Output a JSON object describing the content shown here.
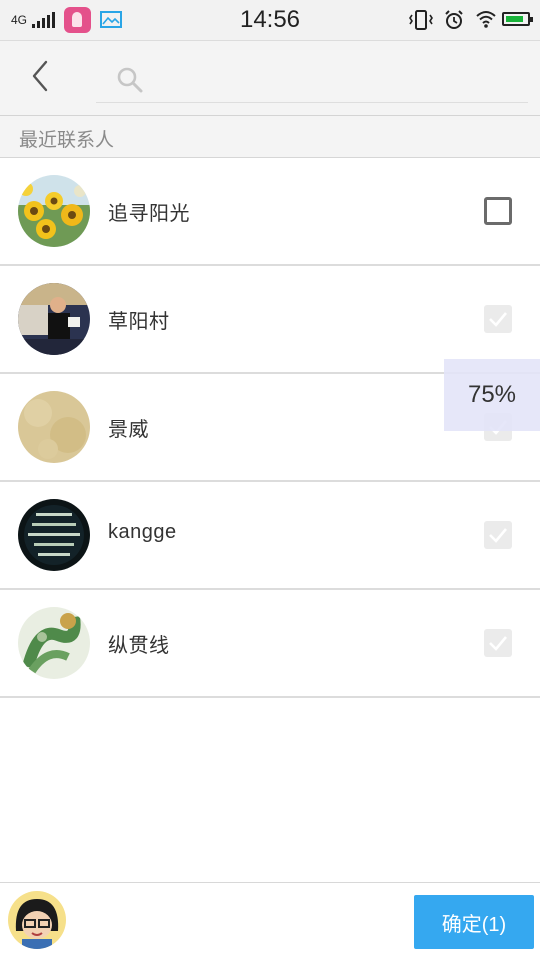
{
  "status_bar": {
    "network": "4G",
    "time": "14:56",
    "battery_level": 0.85,
    "colors": {
      "app_icon": "#e4518b",
      "image_icon": "#2aa5e6",
      "battery": "#19b33a"
    }
  },
  "header": {
    "back_icon": "chevron-left-icon",
    "search_icon": "search-icon",
    "search_placeholder": "",
    "search_value": ""
  },
  "section": {
    "title": "最近联系人"
  },
  "contacts": [
    {
      "name": "追寻阳光",
      "checked": false,
      "avatar": "sunflower-photo"
    },
    {
      "name": "草阳村",
      "checked": true,
      "avatar": "person-photo"
    },
    {
      "name": "景威",
      "checked": true,
      "avatar": "beige-texture"
    },
    {
      "name": "kangge",
      "checked": true,
      "avatar": "calligraphy-photo"
    },
    {
      "name": "纵贯线",
      "checked": true,
      "avatar": "dragon-photo"
    }
  ],
  "overlay": {
    "text": "75%"
  },
  "bottom_bar": {
    "user_avatar": "cartoon-avatar",
    "confirm_label": "确定(1)",
    "confirm_color": "#35a8f0"
  }
}
